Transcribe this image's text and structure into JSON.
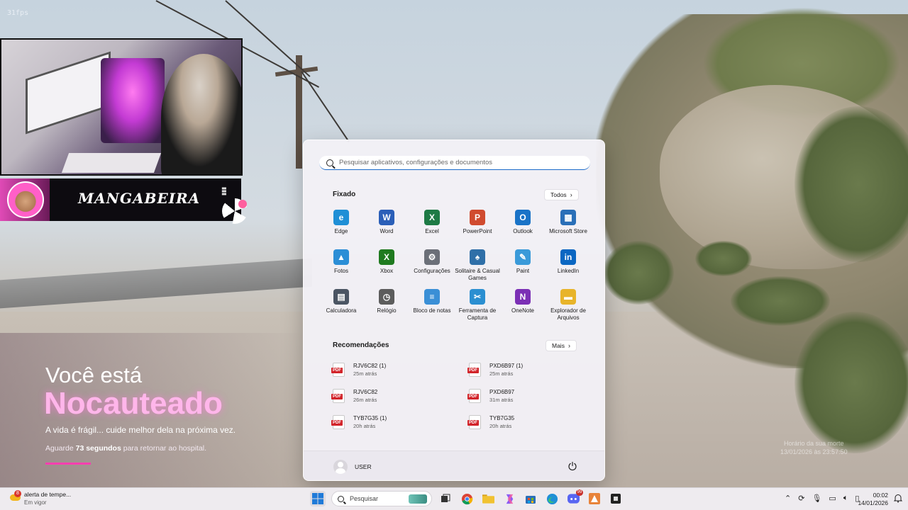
{
  "overlay": {
    "fps": "31fps",
    "streamer_name": "MANGABEIRA"
  },
  "knockout": {
    "line1": "Você está",
    "line2": "Nocauteado",
    "subtitle": "A vida é frágil... cuide melhor dela na próxima vez.",
    "wait_prefix": "Aguarde",
    "wait_seconds": "73 segundos",
    "wait_suffix": "para retornar ao hospital.",
    "death_label": "Horário da sua morte",
    "death_time": "13/01/2026 às 23:57:50"
  },
  "start_menu": {
    "search_placeholder": "Pesquisar aplicativos, configurações e documentos",
    "pinned_title": "Fixado",
    "all_button": "Todos",
    "pinned": [
      {
        "label": "Edge",
        "icon": "edge-icon",
        "color": "#1f8fd6",
        "glyph": "e"
      },
      {
        "label": "Word",
        "icon": "word-icon",
        "color": "#2b5fb8",
        "glyph": "W"
      },
      {
        "label": "Excel",
        "icon": "excel-icon",
        "color": "#1e7a45",
        "glyph": "X"
      },
      {
        "label": "PowerPoint",
        "icon": "powerpoint-icon",
        "color": "#d04b2f",
        "glyph": "P"
      },
      {
        "label": "Outlook",
        "icon": "outlook-icon",
        "color": "#1a73c7",
        "glyph": "O"
      },
      {
        "label": "Microsoft Store",
        "icon": "store-icon",
        "color": "#2a6fb8",
        "glyph": "▦"
      },
      {
        "label": "Fotos",
        "icon": "photos-icon",
        "color": "#2b8ed6",
        "glyph": "▲"
      },
      {
        "label": "Xbox",
        "icon": "xbox-icon",
        "color": "#1f7a1f",
        "glyph": "X"
      },
      {
        "label": "Configurações",
        "icon": "settings-icon",
        "color": "#6b6f78",
        "glyph": "⚙"
      },
      {
        "label": "Solitaire & Casual Games",
        "icon": "solitaire-icon",
        "color": "#2f6fa8",
        "glyph": "♠"
      },
      {
        "label": "Paint",
        "icon": "paint-icon",
        "color": "#3a9ad9",
        "glyph": "✎"
      },
      {
        "label": "LinkedIn",
        "icon": "linkedin-icon",
        "color": "#0a66c2",
        "glyph": "in"
      },
      {
        "label": "Calculadora",
        "icon": "calculator-icon",
        "color": "#4b5563",
        "glyph": "▤"
      },
      {
        "label": "Relógio",
        "icon": "clock-icon",
        "color": "#5c5c5c",
        "glyph": "◷"
      },
      {
        "label": "Bloco de notas",
        "icon": "notepad-icon",
        "color": "#3a8fd6",
        "glyph": "≡"
      },
      {
        "label": "Ferramenta de Captura",
        "icon": "snipping-icon",
        "color": "#2b8fd1",
        "glyph": "✂"
      },
      {
        "label": "OneNote",
        "icon": "onenote-icon",
        "color": "#7b2fb5",
        "glyph": "N"
      },
      {
        "label": "Explorador de Arquivos",
        "icon": "folder-icon",
        "color": "#e8b42a",
        "glyph": "▬"
      }
    ],
    "recs_title": "Recomendações",
    "more_button": "Mais",
    "recommendations": [
      {
        "name": "RJV6C82 (1)",
        "time": "25m atrás"
      },
      {
        "name": "PXD6B97 (1)",
        "time": "25m atrás"
      },
      {
        "name": "RJV6C82",
        "time": "26m atrás"
      },
      {
        "name": "PXD6B97",
        "time": "31m atrás"
      },
      {
        "name": "TYB7G35 (1)",
        "time": "20h atrás"
      },
      {
        "name": "TYB7G35",
        "time": "20h atrás"
      }
    ],
    "user_name": "USER"
  },
  "taskbar": {
    "weather_badge": "8",
    "weather_title": "alerta de tempe...",
    "weather_sub": "Em vigor",
    "search_label": "Pesquisar",
    "discord_badge": "99",
    "clock_time": "00:02",
    "clock_date": "14/01/2026"
  },
  "colors": {
    "accent": "#1a6ac9",
    "knockout_pink": "#ffb6ea",
    "progress": "#ff3fb0"
  }
}
